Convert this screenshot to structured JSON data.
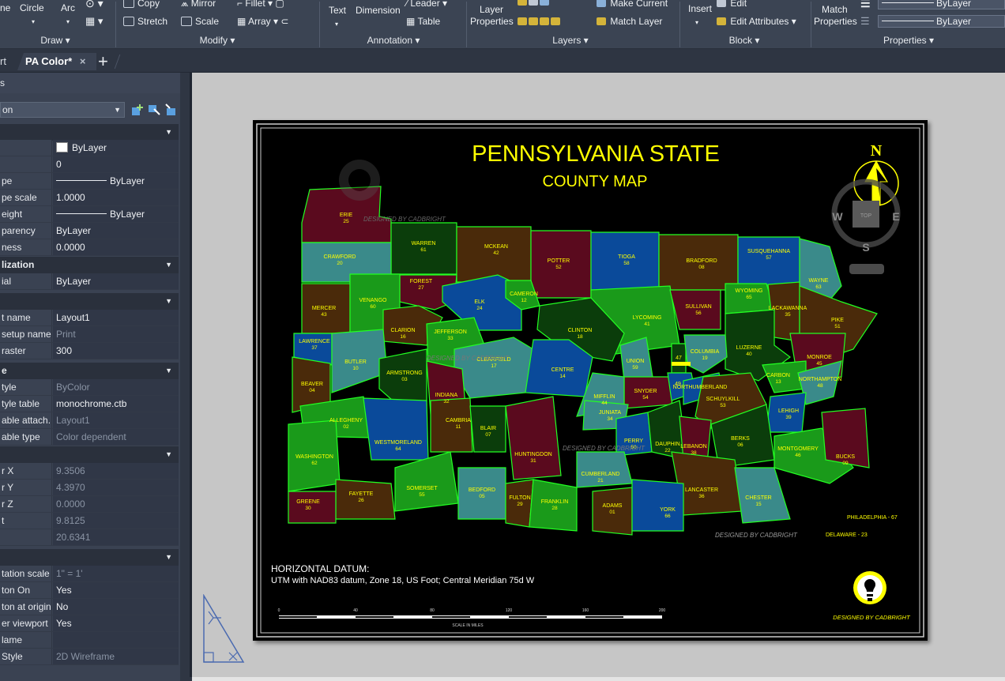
{
  "ribbon": {
    "draw": {
      "line_partial": "ne",
      "circle": "Circle",
      "arc": "Arc",
      "title": "Draw"
    },
    "modify": {
      "copy": "Copy",
      "mirror": "Mirror",
      "fillet": "Fillet",
      "stretch": "Stretch",
      "scale": "Scale",
      "array": "Array",
      "title": "Modify"
    },
    "annotation": {
      "text": "Text",
      "dimension": "Dimension",
      "leader": "Leader",
      "table": "Table",
      "title": "Annotation"
    },
    "layers": {
      "layer_properties_line1": "Layer",
      "layer_properties_line2": "Properties",
      "make_current": "Make Current",
      "match_layer": "Match Layer",
      "title": "Layers"
    },
    "block": {
      "insert": "Insert",
      "edit": "Edit",
      "edit_attributes": "Edit Attributes",
      "title": "Block"
    },
    "properties": {
      "match_line1": "Match",
      "match_line2": "Properties",
      "lineweight": "ByLayer",
      "linetype": "ByLayer",
      "title": "Properties"
    }
  },
  "tabs": {
    "previous_partial": "rt",
    "active": "PA Color*",
    "close": "×",
    "new": "+"
  },
  "palette": {
    "title_partial": "s",
    "object_type_partial": "on",
    "sections": [
      {
        "name": "",
        "rows": [
          {
            "name": "",
            "value": "ByLayer",
            "swatch": "#ffffff",
            "dim": false
          },
          {
            "name": "",
            "value": "0",
            "dim": false
          },
          {
            "name": "pe",
            "value": "ByLayer",
            "line": true,
            "dim": false
          },
          {
            "name": "pe scale",
            "value": "1.0000",
            "dim": false
          },
          {
            "name": "eight",
            "value": "ByLayer",
            "line": true,
            "dim": false
          },
          {
            "name": "parency",
            "value": "ByLayer",
            "dim": false
          },
          {
            "name": "ness",
            "value": "0.0000",
            "dim": false
          }
        ]
      },
      {
        "name": "lization",
        "rows": [
          {
            "name": "ial",
            "value": "ByLayer",
            "dim": false
          }
        ]
      },
      {
        "name": "",
        "rows": [
          {
            "name": "t name",
            "value": "Layout1",
            "dim": false
          },
          {
            "name": "setup name",
            "value": "Print",
            "dim": true
          },
          {
            "name": " raster",
            "value": "300",
            "dim": false
          }
        ]
      },
      {
        "name": "e",
        "rows": [
          {
            "name": "tyle",
            "value": "ByColor",
            "dim": true
          },
          {
            "name": "tyle table",
            "value": "monochrome.ctb",
            "dim": false
          },
          {
            "name": "able attach...",
            "value": "Layout1",
            "dim": true
          },
          {
            "name": "able type",
            "value": "Color dependent",
            "dim": true
          }
        ]
      },
      {
        "name": "",
        "rows": [
          {
            "name": "r X",
            "value": "9.3506",
            "dim": true
          },
          {
            "name": "r Y",
            "value": "4.3970",
            "dim": true
          },
          {
            "name": "r Z",
            "value": "0.0000",
            "dim": true
          },
          {
            "name": "t",
            "value": "9.8125",
            "dim": true
          },
          {
            "name": "",
            "value": "20.6341",
            "dim": true
          }
        ]
      },
      {
        "name": "",
        "rows": [
          {
            "name": "tation scale",
            "value": "1\" = 1'",
            "dim": true
          },
          {
            "name": "ton On",
            "value": "Yes",
            "dim": false
          },
          {
            "name": "ton at origin",
            "value": "No",
            "dim": false
          },
          {
            "name": "er viewport",
            "value": "Yes",
            "dim": false
          },
          {
            "name": "lame",
            "value": "",
            "dim": false
          },
          {
            "name": " Style",
            "value": "2D Wireframe",
            "dim": true
          }
        ]
      }
    ]
  },
  "map": {
    "title": "PENNSYLVANIA STATE",
    "subtitle": "COUNTY MAP",
    "north": "N",
    "compass": {
      "w": "W",
      "e": "E",
      "s": "S",
      "top": "TOP"
    },
    "watermark": "DESIGNED BY CADBRIGHT",
    "datum_title": "HORIZONTAL DATUM:",
    "datum_text": "UTM with NAD83 datum, Zone 18, US Foot; Central Meridian 75d W",
    "scale_ticks": [
      "0",
      "40",
      "80",
      "120",
      "160",
      "200"
    ],
    "scale_caption": "SCALE IN MILES",
    "brand": "DESIGNED BY CADBRIGHT",
    "counties": [
      {
        "n": "ERIE",
        "i": "25"
      },
      {
        "n": "WARREN",
        "i": "61"
      },
      {
        "n": "MCKEAN",
        "i": "42"
      },
      {
        "n": "POTTER",
        "i": "52"
      },
      {
        "n": "TIOGA",
        "i": "58"
      },
      {
        "n": "BRADFORD",
        "i": "08"
      },
      {
        "n": "SUSQUEHANNA",
        "i": "57"
      },
      {
        "n": "WAYNE",
        "i": "63"
      },
      {
        "n": "CRAWFORD",
        "i": "20"
      },
      {
        "n": "FOREST",
        "i": "27"
      },
      {
        "n": "ELK",
        "i": "24"
      },
      {
        "n": "CAMERON",
        "i": "12"
      },
      {
        "n": "LYCOMING",
        "i": "41"
      },
      {
        "n": "SULLIVAN",
        "i": "56"
      },
      {
        "n": "WYOMING",
        "i": "65"
      },
      {
        "n": "LACKAWANNA",
        "i": "35"
      },
      {
        "n": "PIKE",
        "i": "51"
      },
      {
        "n": "MERCER",
        "i": "43"
      },
      {
        "n": "VENANGO",
        "i": "60"
      },
      {
        "n": "CLARION",
        "i": "16"
      },
      {
        "n": "JEFFERSON",
        "i": "33"
      },
      {
        "n": "CLINTON",
        "i": "18"
      },
      {
        "n": "LUZERNE",
        "i": "40"
      },
      {
        "n": "LAWRENCE",
        "i": "37"
      },
      {
        "n": "BUTLER",
        "i": "10"
      },
      {
        "n": "CLEARFIELD",
        "i": "17"
      },
      {
        "n": "CENTRE",
        "i": "14"
      },
      {
        "n": "UNION",
        "i": "59"
      },
      {
        "n": "47",
        "i": ""
      },
      {
        "n": "COLUMBIA",
        "i": "19"
      },
      {
        "n": "MONROE",
        "i": "45"
      },
      {
        "n": "ARMSTRONG",
        "i": "03"
      },
      {
        "n": "CARBON",
        "i": "13"
      },
      {
        "n": "BEAVER",
        "i": "04"
      },
      {
        "n": "INDIANA",
        "i": "32"
      },
      {
        "n": "SNYDER",
        "i": "54"
      },
      {
        "n": "49",
        "i": ""
      },
      {
        "n": "NORTHUMBERLAND",
        "i": ""
      },
      {
        "n": "NORTHAMPTON",
        "i": "48"
      },
      {
        "n": "MIFFLIN",
        "i": "44"
      },
      {
        "n": "SCHUYLKILL",
        "i": "53"
      },
      {
        "n": "ALLEGHENY",
        "i": "02"
      },
      {
        "n": "JUNIATA",
        "i": "34"
      },
      {
        "n": "LEHIGH",
        "i": "39"
      },
      {
        "n": "CAMBRIA",
        "i": "11"
      },
      {
        "n": "BLAIR",
        "i": "07"
      },
      {
        "n": "PERRY",
        "i": "50"
      },
      {
        "n": "DAUPHIN",
        "i": "22"
      },
      {
        "n": "LEBANON",
        "i": "38"
      },
      {
        "n": "BERKS",
        "i": "06"
      },
      {
        "n": "WESTMORELAND",
        "i": "64"
      },
      {
        "n": "WASHINGTON",
        "i": "62"
      },
      {
        "n": "HUNTINGDON",
        "i": "31"
      },
      {
        "n": "MONTGOMERY",
        "i": "46"
      },
      {
        "n": "BUCKS",
        "i": "09"
      },
      {
        "n": "CUMBERLAND",
        "i": "21"
      },
      {
        "n": "SOMERSET",
        "i": "55"
      },
      {
        "n": "BEDFORD",
        "i": "05"
      },
      {
        "n": "LANCASTER",
        "i": "36"
      },
      {
        "n": "CHESTER",
        "i": "15"
      },
      {
        "n": "FAYETTE",
        "i": "26"
      },
      {
        "n": "GREENE",
        "i": "30"
      },
      {
        "n": "FULTON",
        "i": "29"
      },
      {
        "n": "FRANKLIN",
        "i": "28"
      },
      {
        "n": "ADAMS",
        "i": "01"
      },
      {
        "n": "YORK",
        "i": "66"
      },
      {
        "n": "PHILADELPHIA - 67",
        "i": ""
      },
      {
        "n": "DELAWARE - 23",
        "i": ""
      }
    ]
  },
  "colors": {
    "ribbon_bg": "#3b4453",
    "palette_bg": "#3a4252",
    "canvas_bg": "#c6c6c6",
    "map_title": "#ffff00",
    "county_border": "#22ff22",
    "county_fills": [
      "#5a0a1e",
      "#0b3d0b",
      "#4a2a0a",
      "#3a8a8a",
      "#0a4a9a",
      "#1a9a1a"
    ]
  }
}
